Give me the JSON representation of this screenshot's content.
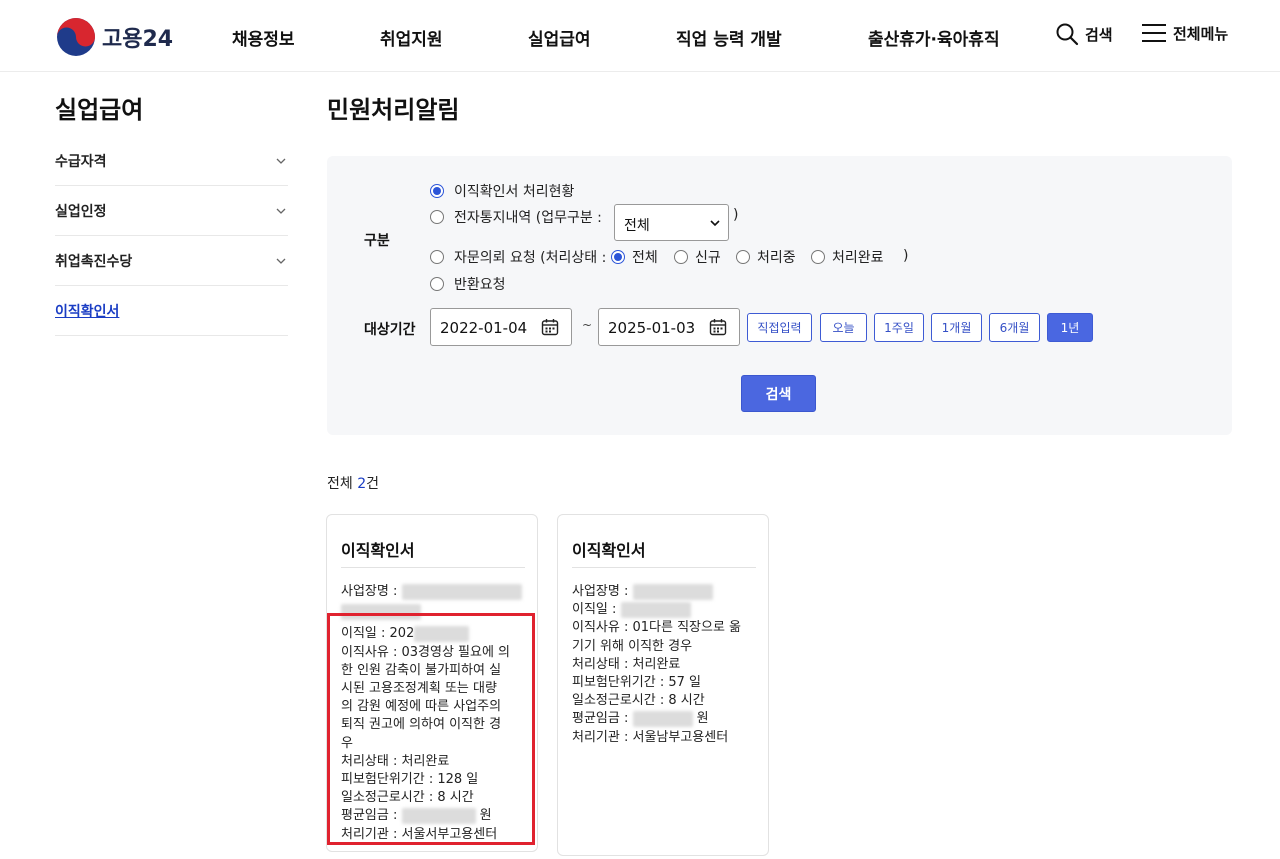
{
  "brand": {
    "name": "고용24"
  },
  "gnb": [
    "채용정보",
    "취업지원",
    "실업급여",
    "직업 능력 개발",
    "출산휴가·육아휴직"
  ],
  "utility": {
    "search_label": "검색",
    "menu_label": "전체메뉴"
  },
  "sidebar": {
    "title": "실업급여",
    "items": [
      {
        "label": "수급자격"
      },
      {
        "label": "실업인정"
      },
      {
        "label": "취업촉진수당"
      },
      {
        "label": "이직확인서"
      }
    ]
  },
  "page": {
    "title": "민원처리알림"
  },
  "filter": {
    "category_label": "구분",
    "radio_options": [
      {
        "label": "이직확인서 처리현황",
        "checked": true
      },
      {
        "label": "전자통지내역 (업무구분 :",
        "checked": false
      },
      {
        "label": "자문의뢰 요청 (처리상태 :",
        "checked": false
      },
      {
        "label": "반환요청",
        "checked": false
      }
    ],
    "work_select_value": "전체",
    "close_paren": ")",
    "status_options": [
      {
        "label": "전체",
        "checked": true
      },
      {
        "label": "신규",
        "checked": false
      },
      {
        "label": "처리중",
        "checked": false
      },
      {
        "label": "처리완료",
        "checked": false
      }
    ],
    "period_label": "대상기간",
    "date_from": "2022-01-04",
    "date_to": "2025-01-03",
    "tilde": "~",
    "period_buttons": [
      {
        "label": "직접입력",
        "active": false
      },
      {
        "label": "오늘",
        "active": false
      },
      {
        "label": "1주일",
        "active": false
      },
      {
        "label": "1개월",
        "active": false
      },
      {
        "label": "6개월",
        "active": false
      },
      {
        "label": "1년",
        "active": true
      }
    ],
    "search_button": "검색"
  },
  "results": {
    "total_prefix": "전체 ",
    "total_count": "2",
    "total_suffix": "건"
  },
  "cards": [
    {
      "title": "이직확인서",
      "company_label": "사업장명 : ",
      "leave_date_label": "이직일 : 202",
      "reason": "이직사유 : 03경영상 필요에 의\n한 인원 감축이 불가피하여 실\n시된 고용조정계획 또는 대량\n의 감원 예정에 따른 사업주의\n퇴직 권고에 의하여 이직한 경\n우",
      "status": "처리상태 : 처리완료",
      "insured_period": "피보험단위기간 : 128 일",
      "daily_hours": "일소정근로시간 : 8 시간",
      "avg_wage_label": "평균임금 : ",
      "avg_wage_unit": " 원",
      "agency": "처리기관 : 서울서부고용센터"
    },
    {
      "title": "이직확인서",
      "company_label": "사업장명 : ",
      "leave_date_label": "이직일 : ",
      "reason": "이직사유 : 01다른 직장으로 옮\n기기 위해 이직한 경우",
      "status": "처리상태 : 처리완료",
      "insured_period": "피보험단위기간 : 57 일",
      "daily_hours": "일소정근로시간 : 8 시간",
      "avg_wage_label": "평균임금 : ",
      "avg_wage_unit": " 원",
      "agency": "처리기관 : 서울남부고용센터"
    }
  ],
  "colors": {
    "accent": "#4b67e0",
    "highlight": "#e0222f",
    "link": "#1a3dc4"
  },
  "icons": [
    "government-emblem-icon",
    "search-icon",
    "hamburger-menu-icon",
    "chevron-down-icon",
    "calendar-icon"
  ]
}
